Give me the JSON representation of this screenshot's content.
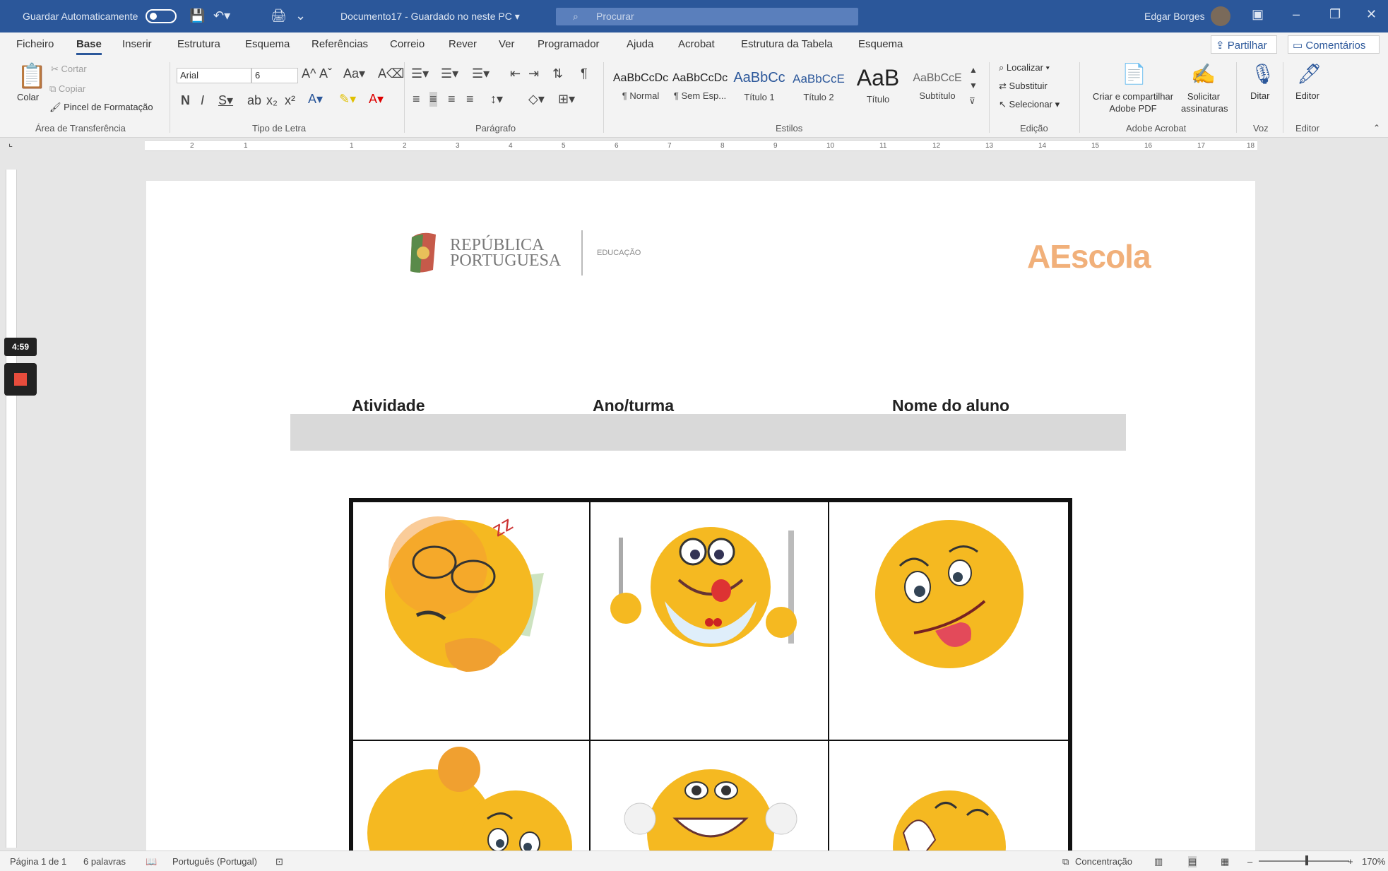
{
  "titlebar": {
    "autosave_label": "Guardar Automaticamente",
    "doc_title": "Documento17  -  Guardado no neste PC  ▾",
    "search_placeholder": "Procurar",
    "user_name": "Edgar Borges"
  },
  "menu": {
    "tabs": [
      "Ficheiro",
      "Base",
      "Inserir",
      "Estrutura",
      "Esquema",
      "Referências",
      "Correio",
      "Rever",
      "Ver",
      "Programador",
      "Ajuda",
      "Acrobat",
      "Estrutura da Tabela",
      "Esquema"
    ],
    "active_tab": "Base",
    "share_label": "Partilhar",
    "comments_label": "Comentários"
  },
  "ribbon": {
    "clipboard": {
      "paste": "Colar",
      "cut": "Cortar",
      "copy": "Copiar",
      "format_painter": "Pincel de Formatação",
      "label": "Área de Transferência"
    },
    "font": {
      "name": "Arial",
      "size": "6",
      "label": "Tipo de Letra"
    },
    "paragraph": {
      "label": "Parágrafo"
    },
    "styles": {
      "items": [
        {
          "preview": "AaBbCcDc",
          "name": "¶ Normal"
        },
        {
          "preview": "AaBbCcDc",
          "name": "¶ Sem Esp..."
        },
        {
          "preview": "AaBbCc",
          "name": "Título 1"
        },
        {
          "preview": "AaBbCcE",
          "name": "Título 2"
        },
        {
          "preview": "AaB",
          "name": "Título"
        },
        {
          "preview": "AaBbCcE",
          "name": "Subtítulo"
        }
      ],
      "label": "Estilos"
    },
    "editing": {
      "find": "Localizar",
      "replace": "Substituir",
      "select": "Selecionar",
      "label": "Edição"
    },
    "acrobat": {
      "create": "Criar e compartilhar Adobe PDF",
      "request": "Solicitar assinaturas",
      "label": "Adobe Acrobat"
    },
    "voice": {
      "dictate": "Ditar",
      "label": "Voz"
    },
    "editor": {
      "editor": "Editor",
      "label": "Editor"
    }
  },
  "ruler_ticks": [
    "2",
    "1",
    "1",
    "2",
    "3",
    "4",
    "5",
    "6",
    "7",
    "8",
    "9",
    "10",
    "11",
    "12",
    "13",
    "14",
    "15",
    "16",
    "17",
    "18"
  ],
  "recording": {
    "time": "4:59"
  },
  "document": {
    "logo_lines": [
      "REPÚBLICA",
      "PORTUGUESA"
    ],
    "logo_sub": "EDUCAÇÃO",
    "brand": "AEscola",
    "headers": {
      "activity": "Atividade",
      "class": "Ano/turma",
      "student": "Nome do aluno"
    },
    "emoji_cells": [
      "sleeping-emoji",
      "hungry-emoji",
      "silly-tongue-emoji",
      "thumbs-up-emoji",
      "grinning-ears-emoji",
      "laughing-emoji"
    ]
  },
  "status": {
    "page": "Página 1 de 1",
    "words": "6 palavras",
    "language": "Português (Portugal)",
    "focus": "Concentração",
    "zoom": "170%"
  },
  "colors": {
    "accent": "#2b579a",
    "emoji_yellow": "#f5b921"
  }
}
